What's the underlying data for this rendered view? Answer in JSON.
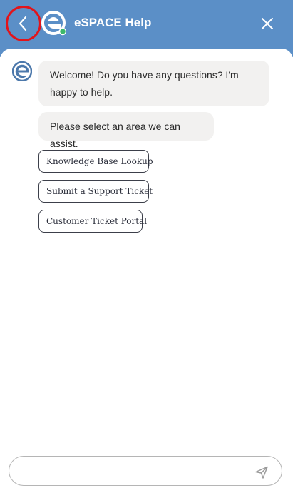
{
  "header": {
    "title": "eSPACE Help",
    "back_icon": "chevron-left-icon",
    "close_icon": "close-icon",
    "logo": "espace-logo"
  },
  "colors": {
    "header_bg": "#5b8fc7",
    "highlight_ring": "#e2141b",
    "bubble_bg": "#f2f1f0"
  },
  "messages": [
    {
      "text": "Welcome! Do you have any questions? I'm happy to help."
    },
    {
      "text": "Please select an area we can assist."
    }
  ],
  "options": [
    {
      "label": "Knowledge Base Lookup"
    },
    {
      "label": "Submit a Support Ticket"
    },
    {
      "label": "Customer Ticket Portal"
    }
  ],
  "composer": {
    "value": "",
    "placeholder": "",
    "send_icon": "send-icon"
  }
}
